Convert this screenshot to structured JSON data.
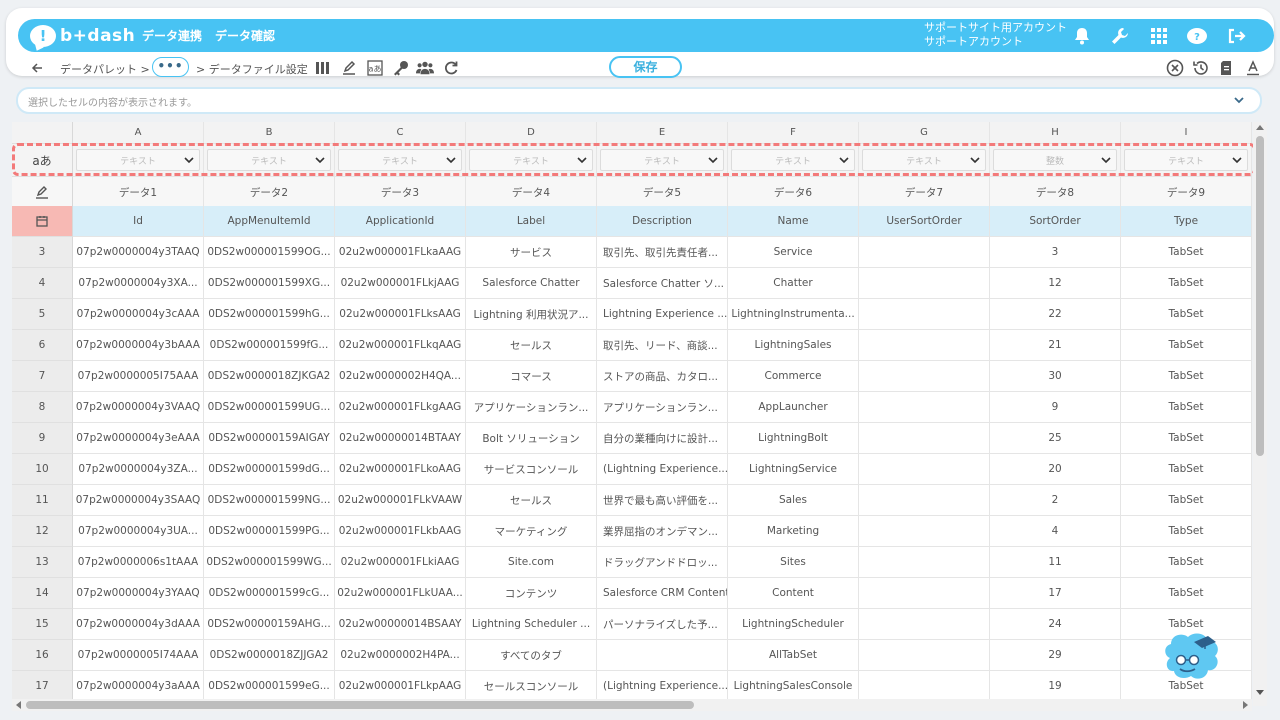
{
  "app": {
    "logo_text": "b+dash"
  },
  "nav": [
    "データ連携",
    "データ確認"
  ],
  "account": {
    "line1": "サポートサイト用アカウント",
    "line2": "サポートアカウント"
  },
  "toolbar": {
    "back_icon": "arrow-left-icon",
    "crumb1": "データパレット >",
    "ellipsis": "•••",
    "crumb2": "> データファイル設定",
    "save": "保存"
  },
  "cell_bar": {
    "placeholder": "選択したセルの内容が表示されます。"
  },
  "grid": {
    "type_row_label": "aあ",
    "letters": [
      "A",
      "B",
      "C",
      "D",
      "E",
      "F",
      "G",
      "H",
      "I"
    ],
    "types": [
      "テキスト",
      "テキスト",
      "テキスト",
      "テキスト",
      "テキスト",
      "テキスト",
      "テキスト",
      "整数",
      "テキスト"
    ],
    "labels": [
      "データ1",
      "データ2",
      "データ3",
      "データ4",
      "データ5",
      "データ6",
      "データ7",
      "データ8",
      "データ9"
    ],
    "fields": [
      "Id",
      "AppMenuItemId",
      "ApplicationId",
      "Label",
      "Description",
      "Name",
      "UserSortOrder",
      "SortOrder",
      "Type"
    ],
    "rows": [
      {
        "n": "3",
        "c": [
          "07p2w0000004y3TAAQ",
          "0DS2w000001599OG...",
          "02u2w000001FLkaAAG",
          "サービス",
          "取引先、取引先責任者...",
          "Service",
          "",
          "3",
          "TabSet"
        ]
      },
      {
        "n": "4",
        "c": [
          "07p2w0000004y3XA...",
          "0DS2w000001599XG...",
          "02u2w000001FLkjAAG",
          "Salesforce Chatter",
          "Salesforce Chatter ソ...",
          "Chatter",
          "",
          "12",
          "TabSet"
        ]
      },
      {
        "n": "5",
        "c": [
          "07p2w0000004y3cAAA",
          "0DS2w000001599hG...",
          "02u2w000001FLksAAG",
          "Lightning 利用状況ア...",
          "Lightning Experience ...",
          "LightningInstrumenta...",
          "",
          "22",
          "TabSet"
        ]
      },
      {
        "n": "6",
        "c": [
          "07p2w0000004y3bAAA",
          "0DS2w000001599fG...",
          "02u2w000001FLkqAAG",
          "セールス",
          "取引先、リード、商談...",
          "LightningSales",
          "",
          "21",
          "TabSet"
        ]
      },
      {
        "n": "7",
        "c": [
          "07p2w0000005I75AAA",
          "0DS2w0000018ZJKGA2",
          "02u2w0000002H4QA...",
          "コマース",
          "ストアの商品、カタロ...",
          "Commerce",
          "",
          "30",
          "TabSet"
        ]
      },
      {
        "n": "8",
        "c": [
          "07p2w0000004y3VAAQ",
          "0DS2w000001599UG...",
          "02u2w000001FLkgAAG",
          "アプリケーションラン...",
          "アプリケーションラン...",
          "AppLauncher",
          "",
          "9",
          "TabSet"
        ]
      },
      {
        "n": "9",
        "c": [
          "07p2w0000004y3eAAA",
          "0DS2w00000159AIGAY",
          "02u2w00000014BTAAY",
          "Bolt ソリューション",
          "自分の業種向けに設計...",
          "LightningBolt",
          "",
          "25",
          "TabSet"
        ]
      },
      {
        "n": "10",
        "c": [
          "07p2w0000004y3ZA...",
          "0DS2w000001599dG...",
          "02u2w000001FLkoAAG",
          "サービスコンソール",
          "(Lightning Experience...",
          "LightningService",
          "",
          "20",
          "TabSet"
        ]
      },
      {
        "n": "11",
        "c": [
          "07p2w0000004y3SAAQ",
          "0DS2w000001599NG...",
          "02u2w000001FLkVAAW",
          "セールス",
          "世界で最も高い評価を...",
          "Sales",
          "",
          "2",
          "TabSet"
        ]
      },
      {
        "n": "12",
        "c": [
          "07p2w0000004y3UA...",
          "0DS2w000001599PG...",
          "02u2w000001FLkbAAG",
          "マーケティング",
          "業界屈指のオンデマン...",
          "Marketing",
          "",
          "4",
          "TabSet"
        ]
      },
      {
        "n": "13",
        "c": [
          "07p2w0000006s1tAAA",
          "0DS2w000001599WG...",
          "02u2w000001FLkiAAG",
          "Site.com",
          "ドラッグアンドドロッ...",
          "Sites",
          "",
          "11",
          "TabSet"
        ]
      },
      {
        "n": "14",
        "c": [
          "07p2w0000004y3YAAQ",
          "0DS2w000001599cG...",
          "02u2w000001FLkUAA...",
          "コンテンツ",
          "Salesforce CRM Content",
          "Content",
          "",
          "17",
          "TabSet"
        ]
      },
      {
        "n": "15",
        "c": [
          "07p2w0000004y3dAAA",
          "0DS2w00000159AHG...",
          "02u2w00000014BSAAY",
          "Lightning Scheduler ...",
          "パーソナライズした予...",
          "LightningScheduler",
          "",
          "24",
          "TabSet"
        ]
      },
      {
        "n": "16",
        "c": [
          "07p2w0000005I74AAA",
          "0DS2w0000018ZJJGA2",
          "02u2w0000002H4PA...",
          "すべてのタブ",
          "",
          "AllTabSet",
          "",
          "29",
          "TabSet"
        ]
      },
      {
        "n": "17",
        "c": [
          "07p2w0000004y3aAAA",
          "0DS2w000001599eG...",
          "02u2w000001FLkpAAG",
          "セールスコンソール",
          "(Lightning Experience...",
          "LightningSalesConsole",
          "",
          "19",
          "TabSet"
        ]
      }
    ]
  },
  "colors": {
    "brand": "#48c3f3",
    "highlight_dash": "#f37a7a",
    "field_row": "#d7eef9",
    "row_head_accent": "#f7b9b4"
  }
}
